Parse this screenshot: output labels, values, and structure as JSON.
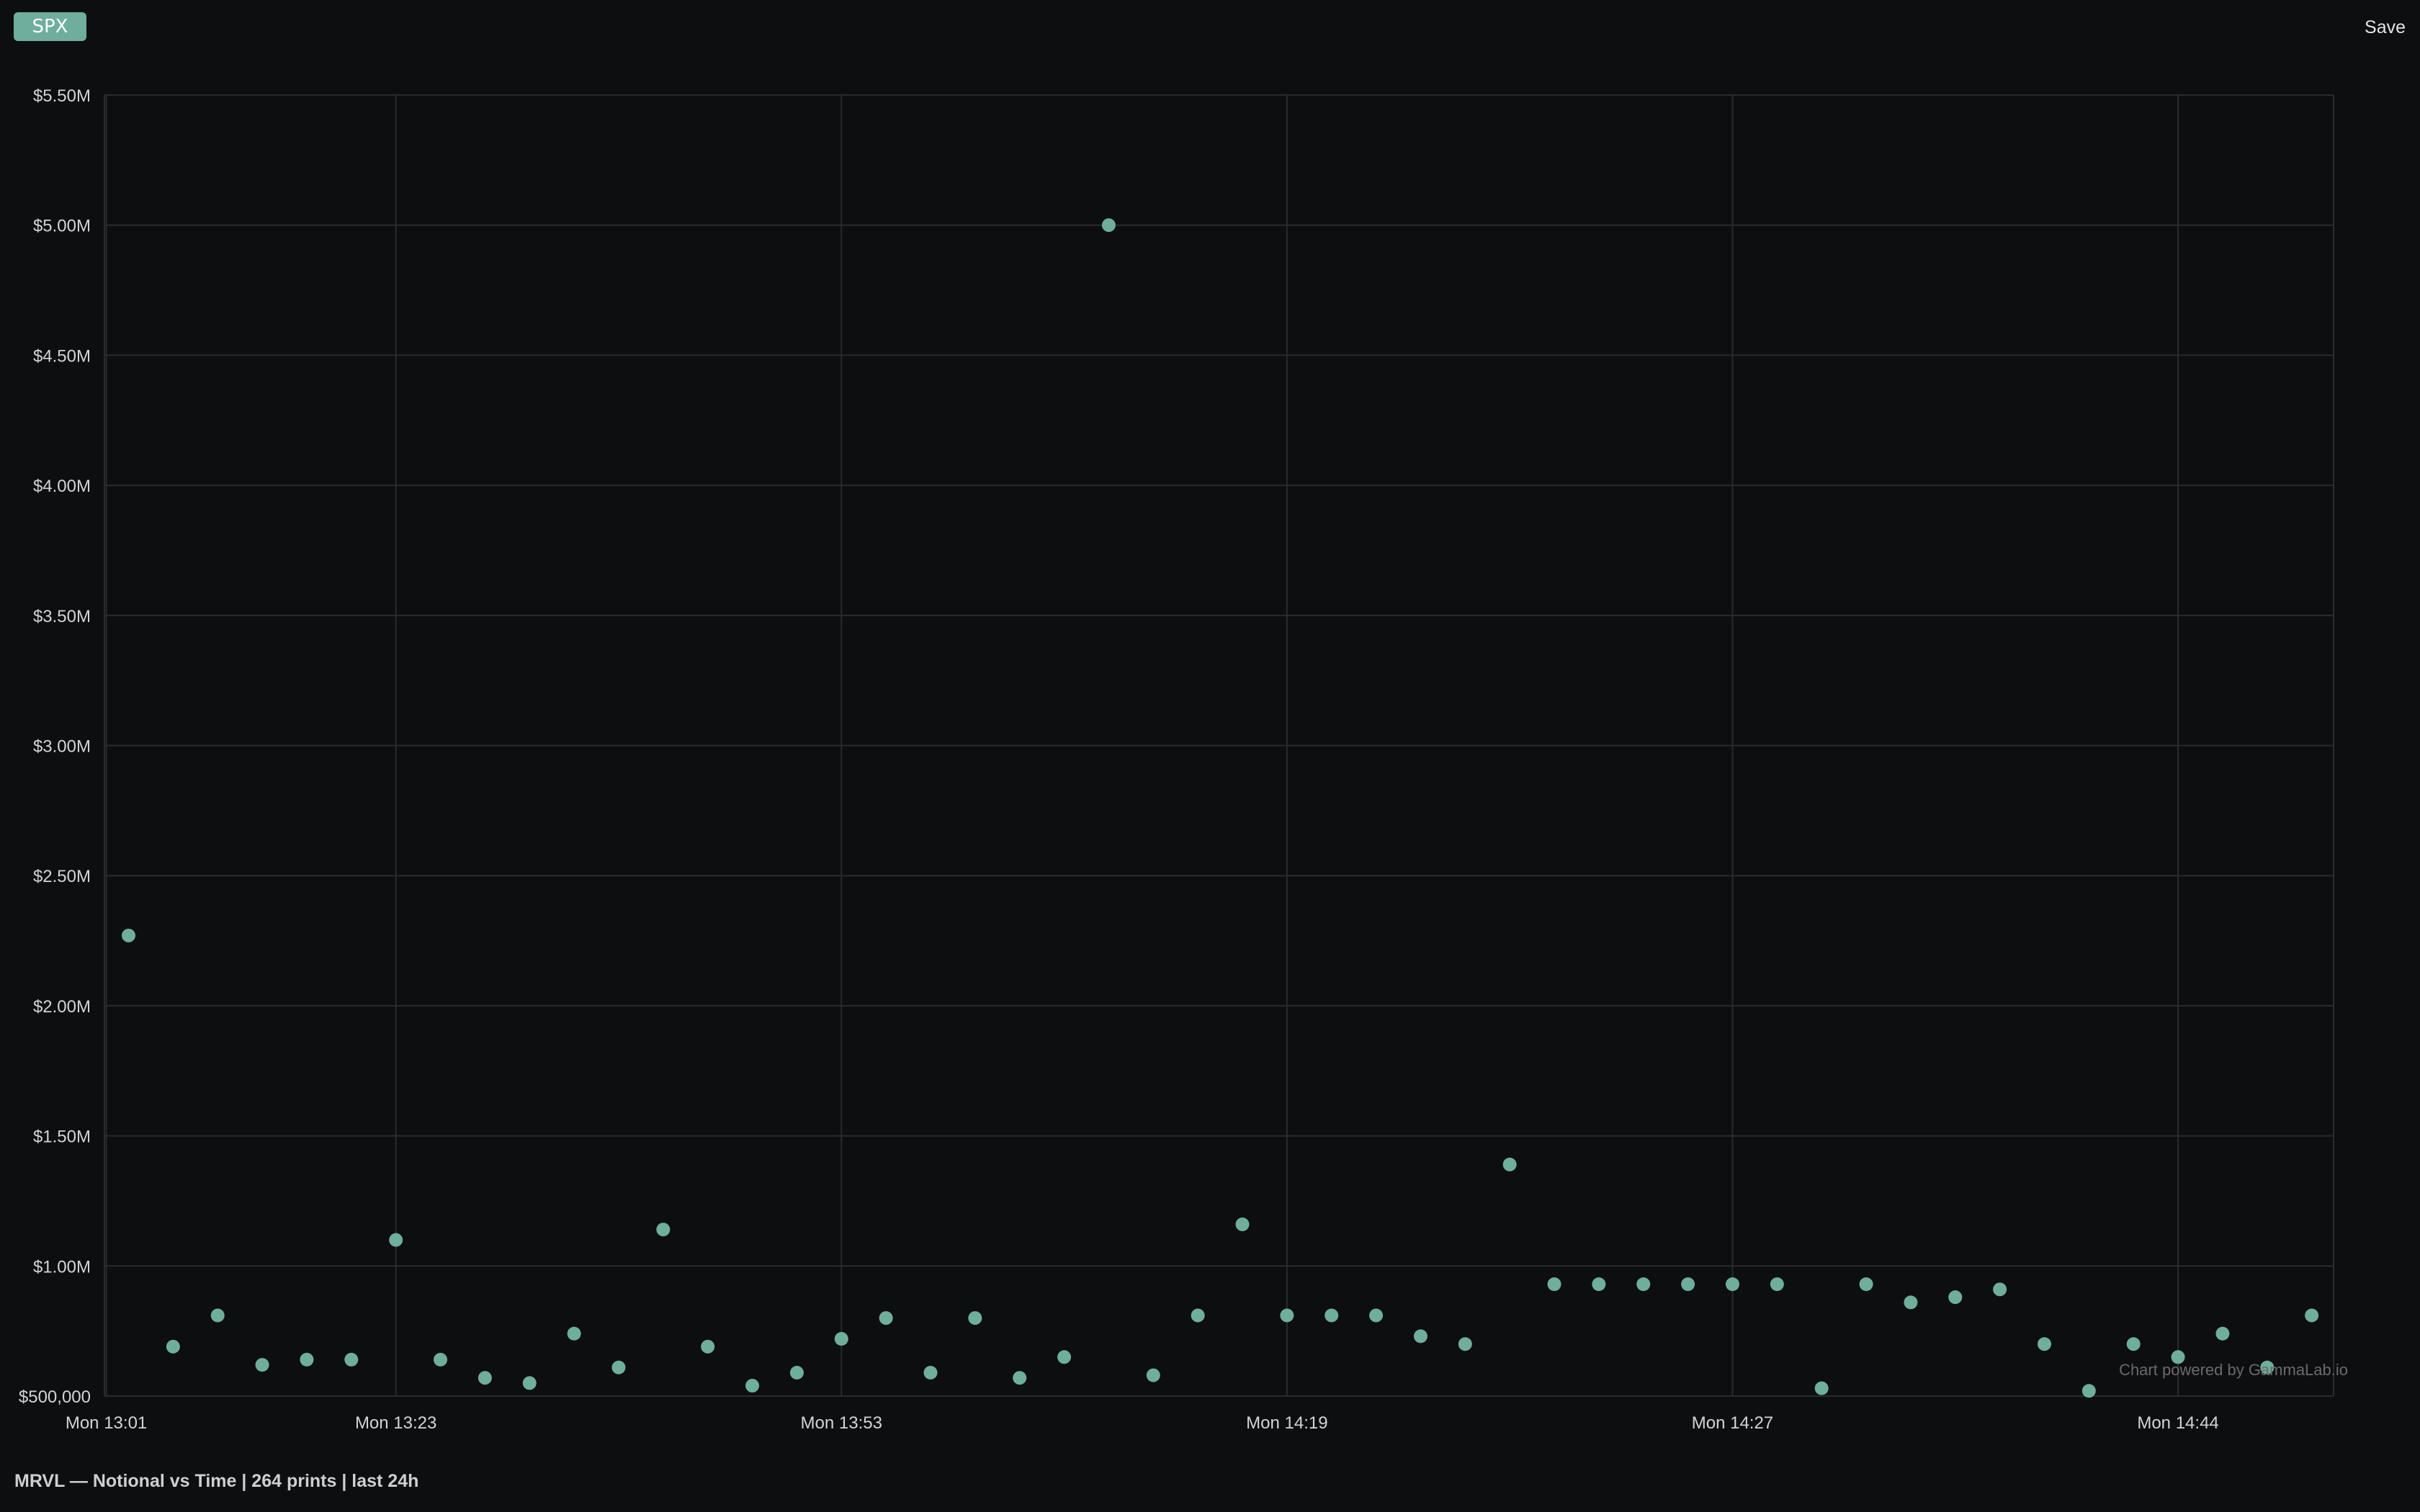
{
  "toolbar": {
    "symbol_badge": "SPX",
    "save_label": "Save"
  },
  "caption": "MRVL — Notional vs Time | 264 prints | last 24h",
  "watermark": "Chart powered by GammaLab.io",
  "colors": {
    "background": "#0d0e10",
    "grid": "#2a2b2e",
    "point": "#6fae9c",
    "badge": "#6fae9c"
  },
  "chart_data": {
    "type": "scatter",
    "grid": true,
    "ylim": [
      500000,
      5500000
    ],
    "y_ticks": [
      500000,
      1000000,
      1500000,
      2000000,
      2500000,
      3000000,
      3500000,
      4000000,
      4500000,
      5000000,
      5500000
    ],
    "y_tick_labels": [
      "$500,000",
      "$1.00M",
      "$1.50M",
      "$2.00M",
      "$2.50M",
      "$3.00M",
      "$3.50M",
      "$4.00M",
      "$4.50M",
      "$5.00M",
      "$5.50M"
    ],
    "x_tick_labels": [
      "Mon 13:01",
      "Mon 13:23",
      "Mon 13:53",
      "Mon 14:19",
      "Mon 14:27",
      "Mon 14:44"
    ],
    "x_tick_index": [
      -0.5,
      6,
      16,
      26,
      36,
      46
    ],
    "x_max_index": 50,
    "values": [
      2270000,
      690000,
      810000,
      620000,
      640000,
      640000,
      1100000,
      640000,
      570000,
      550000,
      740000,
      610000,
      1140000,
      690000,
      540000,
      590000,
      720000,
      800000,
      590000,
      800000,
      570000,
      650000,
      5000000,
      580000,
      810000,
      1160000,
      810000,
      810000,
      810000,
      730000,
      700000,
      1390000,
      930000,
      930000,
      930000,
      930000,
      930000,
      930000,
      530000,
      930000,
      860000,
      880000,
      910000,
      700000,
      520000,
      700000,
      650000,
      740000,
      610000,
      810000
    ]
  }
}
